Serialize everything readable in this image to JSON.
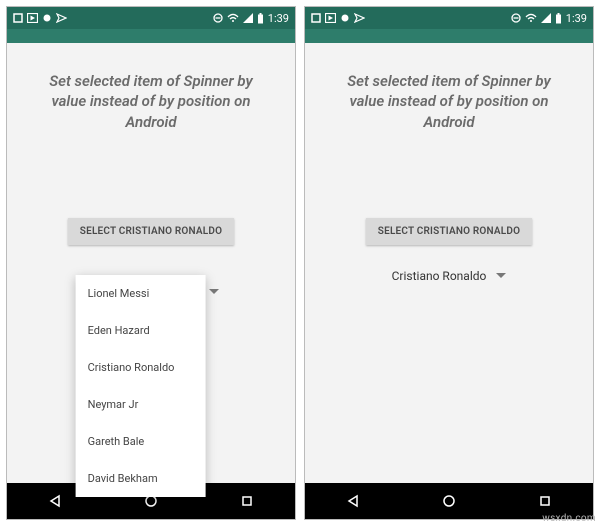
{
  "status": {
    "time": "1:39",
    "icons_left": [
      "square-icon",
      "play-box-icon",
      "circle-icon",
      "send-icon"
    ],
    "icons_right": [
      "minus-circle-icon",
      "wifi-icon",
      "signal-icon",
      "battery-icon"
    ]
  },
  "title": "Set selected item of Spinner by value instead of by position on Android",
  "button_label": "SELECT CRISTIANO RONALDO",
  "spinner": {
    "selected_closed": "Cristiano Ronaldo",
    "options": [
      "Lionel Messi",
      "Eden Hazard",
      "Cristiano Ronaldo",
      "Neymar Jr",
      "Gareth Bale",
      "David Bekham"
    ]
  },
  "watermark": "wsxdn.com"
}
